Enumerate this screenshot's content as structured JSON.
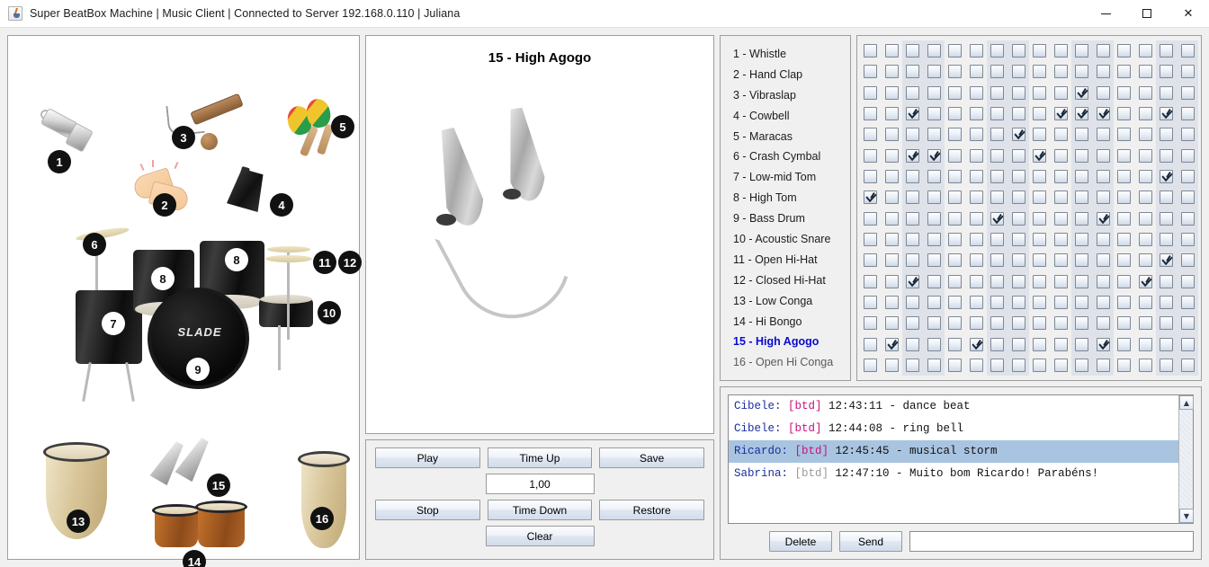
{
  "window": {
    "title": "Super BeatBox Machine | Music Client | Connected to Server 192.168.0.110 | Juliana",
    "app_icon": "java-coffee-cup-icon",
    "minimize_label": "–",
    "maximize_label": "□",
    "close_label": "✕"
  },
  "instrument_gallery": {
    "badges": [
      {
        "n": "1",
        "instrument": "Whistle"
      },
      {
        "n": "2",
        "instrument": "Hand Clap"
      },
      {
        "n": "3",
        "instrument": "Vibraslap"
      },
      {
        "n": "4",
        "instrument": "Cowbell"
      },
      {
        "n": "5",
        "instrument": "Maracas"
      },
      {
        "n": "6",
        "instrument": "Crash Cymbal"
      },
      {
        "n": "7",
        "instrument": "Low-mid Tom"
      },
      {
        "n": "8",
        "instrument": "High Tom"
      },
      {
        "n": "8",
        "instrument": "High Tom"
      },
      {
        "n": "9",
        "instrument": "Bass Drum"
      },
      {
        "n": "10",
        "instrument": "Acoustic Snare"
      },
      {
        "n": "11",
        "instrument": "Open Hi-Hat"
      },
      {
        "n": "12",
        "instrument": "Closed Hi-Hat"
      },
      {
        "n": "13",
        "instrument": "Low Conga"
      },
      {
        "n": "14",
        "instrument": "Hi Bongo"
      },
      {
        "n": "15",
        "instrument": "High Agogo"
      },
      {
        "n": "16",
        "instrument": "Open Hi Conga"
      }
    ]
  },
  "preview": {
    "title": "15 - High Agogo",
    "image_name": "high-agogo-bells"
  },
  "controls": {
    "play": "Play",
    "time_up": "Time Up",
    "save": "Save",
    "tempo_value": "1,00",
    "stop": "Stop",
    "time_down": "Time Down",
    "restore": "Restore",
    "clear": "Clear"
  },
  "instrument_list": {
    "selected_index": 14,
    "items": [
      "1 - Whistle",
      "2 - Hand Clap",
      "3 - Vibraslap",
      "4 - Cowbell",
      "5 - Maracas",
      "6 - Crash Cymbal",
      "7 - Low-mid Tom",
      "8 - High Tom",
      "9 - Bass Drum",
      "10 - Acoustic Snare",
      "11 - Open Hi-Hat",
      "12 - Closed Hi-Hat",
      "13 - Low Conga",
      "14 - Hi Bongo",
      "15 - High Agogo",
      "16 - Open Hi Conga"
    ]
  },
  "beat_grid": {
    "columns": 16,
    "rows": 16,
    "shaded_column_pairs": [
      [
        3,
        4
      ],
      [
        7,
        8
      ],
      [
        11,
        12
      ],
      [
        15,
        16
      ]
    ],
    "checked": [
      [],
      [],
      [
        11
      ],
      [
        3,
        10,
        11,
        12,
        15
      ],
      [
        8
      ],
      [
        3,
        4,
        9
      ],
      [
        15
      ],
      [
        1
      ],
      [
        7,
        12
      ],
      [],
      [
        15
      ],
      [
        3,
        14
      ],
      [],
      [],
      [
        2,
        6,
        12
      ],
      []
    ]
  },
  "chat": {
    "messages": [
      {
        "name": "Cibele:",
        "tag": "[btd]",
        "tag_muted": false,
        "body": "12:43:11 - dance beat",
        "selected": false
      },
      {
        "name": "Cibele:",
        "tag": "[btd]",
        "tag_muted": false,
        "body": "12:44:08 - ring bell",
        "selected": false
      },
      {
        "name": "Ricardo:",
        "tag": "[btd]",
        "tag_muted": false,
        "body": "12:45:45 - musical storm",
        "selected": true
      },
      {
        "name": "Sabrina:",
        "tag": "[btd]",
        "tag_muted": true,
        "body": "12:47:10 - Muito bom Ricardo! Parabéns!",
        "selected": false
      }
    ],
    "scroll_up_label": "▲",
    "scroll_down_label": "▼",
    "delete_label": "Delete",
    "send_label": "Send",
    "input_value": "",
    "input_placeholder": ""
  },
  "colors": {
    "selected_instrument": "#0a0ad0",
    "chat_name": "#1b2f9e",
    "chat_tag": "#c9117e",
    "chat_tag_muted": "#9a9a9a",
    "chat_selection": "#a8c4e0",
    "grid_shade": "#dfe3e9"
  }
}
